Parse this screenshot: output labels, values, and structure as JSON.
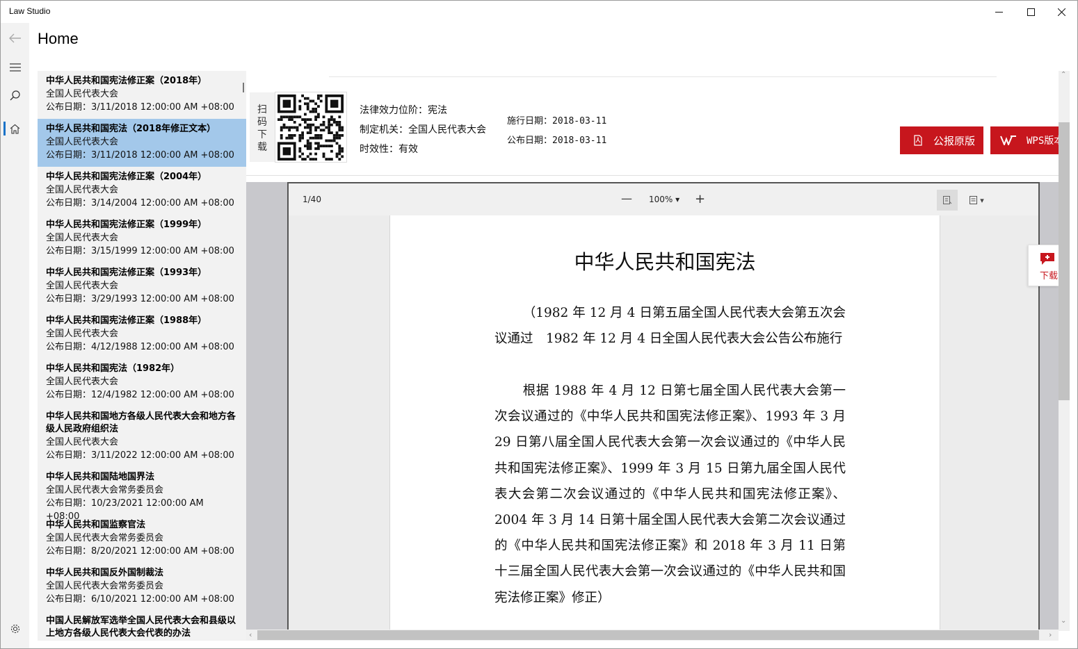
{
  "window": {
    "title": "Law Studio",
    "min": "—",
    "max": "☐",
    "close": "✕"
  },
  "nav": {
    "back_icon": "arrow-left-icon",
    "menu_icon": "hamburger-icon",
    "search_icon": "search-icon",
    "home_icon": "home-icon",
    "settings_icon": "gear-icon"
  },
  "page": {
    "title": "Home"
  },
  "laws": [
    {
      "title": "中华人民共和国宪法修正案（2018年）",
      "org": "全国人民代表大会",
      "date": "公布日期：3/11/2018 12:00:00 AM +08:00"
    },
    {
      "title": "中华人民共和国宪法（2018年修正文本）",
      "org": "全国人民代表大会",
      "date": "公布日期：3/11/2018 12:00:00 AM +08:00"
    },
    {
      "title": "中华人民共和国宪法修正案（2004年）",
      "org": "全国人民代表大会",
      "date": "公布日期：3/14/2004 12:00:00 AM +08:00"
    },
    {
      "title": "中华人民共和国宪法修正案（1999年）",
      "org": "全国人民代表大会",
      "date": "公布日期：3/15/1999 12:00:00 AM +08:00"
    },
    {
      "title": "中华人民共和国宪法修正案（1993年）",
      "org": "全国人民代表大会",
      "date": "公布日期：3/29/1993 12:00:00 AM +08:00"
    },
    {
      "title": "中华人民共和国宪法修正案（1988年）",
      "org": "全国人民代表大会",
      "date": "公布日期：4/12/1988 12:00:00 AM +08:00"
    },
    {
      "title": "中华人民共和国宪法（1982年）",
      "org": "全国人民代表大会",
      "date": "公布日期：12/4/1982 12:00:00 AM +08:00"
    },
    {
      "title": "中华人民共和国地方各级人民代表大会和地方各级人民政府组织法",
      "org": "全国人民代表大会",
      "date": "公布日期：3/11/2022 12:00:00 AM +08:00"
    },
    {
      "title": "中华人民共和国陆地国界法",
      "org": "全国人民代表大会常务委员会",
      "date": "公布日期：10/23/2021 12:00:00 AM +08:00"
    },
    {
      "title": "中华人民共和国监察官法",
      "org": "全国人民代表大会常务委员会",
      "date": "公布日期：8/20/2021 12:00:00 AM +08:00"
    },
    {
      "title": "中华人民共和国反外国制裁法",
      "org": "全国人民代表大会常务委员会",
      "date": "公布日期：6/10/2021 12:00:00 AM +08:00"
    },
    {
      "title": "中国人民解放军选举全国人民代表大会和县级以上地方各级人民代表大会代表的办法",
      "org": "",
      "date": ""
    }
  ],
  "selected_index": 1,
  "detail": {
    "qr_label": "扫码下载",
    "level": "法律效力位阶：宪法",
    "authority": "制定机关：全国人民代表大会",
    "validity": "时效性：有效",
    "effective_date": "施行日期：2018-03-11",
    "publish_date": "公布日期：2018-03-11",
    "btn_original": "公报原版",
    "btn_wps": "WPS版本",
    "accent": "#c7161d"
  },
  "viewer": {
    "page_counter": "1/40",
    "zoom_minus": "—",
    "zoom_level": "100% ▾",
    "zoom_plus": "+",
    "view_mode_caret": "▾"
  },
  "document": {
    "title": "中华人民共和国宪法",
    "para1": "（1982 年 12 月 4 日第五届全国人民代表大会第五次会议通过　1982 年 12 月 4 日全国人民代表大会公告公布施行",
    "para2": "根据 1988 年 4 月 12 日第七届全国人民代表大会第一次会议通过的《中华人民共和国宪法修正案》、1993 年 3 月 29 日第八届全国人民代表大会第一次会议通过的《中华人民共和国宪法修正案》、1999 年 3 月 15 日第九届全国人民代表大会第二次会议通过的《中华人民共和国宪法修正案》、2004 年 3 月 14 日第十届全国人民代表大会第二次会议通过的《中华人民共和国宪法修正案》和 2018 年 3 月 11 日第十三届全国人民代表大会第一次会议通过的《中华人民共和国宪法修正案》修正）"
  },
  "float_download": {
    "label": "下载"
  },
  "scroll": {
    "up": "⌃",
    "down": "⌄",
    "left": "‹",
    "right": "›"
  }
}
